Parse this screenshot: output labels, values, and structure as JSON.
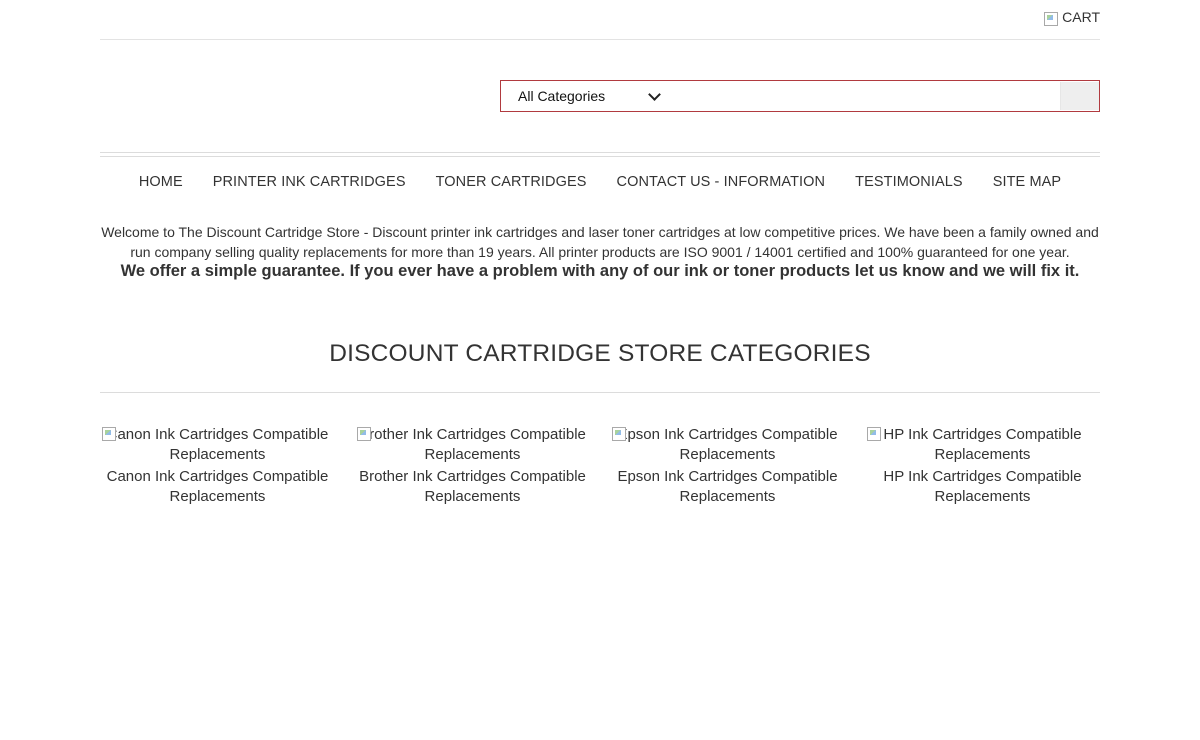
{
  "topbar": {
    "cart_label": "CART"
  },
  "search": {
    "category_selected": "All Categories",
    "input_value": "",
    "input_placeholder": ""
  },
  "nav": [
    "HOME",
    "PRINTER INK CARTRIDGES",
    "TONER CARTRIDGES",
    "CONTACT US - INFORMATION",
    "TESTIMONIALS",
    "SITE MAP"
  ],
  "welcome": {
    "text": "Welcome to The Discount Cartridge Store - Discount printer ink cartridges and laser toner cartridges at low competitive prices. We have been a family owned and run company selling quality replacements for more than 19 years. All printer products are ISO 9001 / 14001 certified and 100% guaranteed for one year.",
    "guarantee": "We offer a simple guarantee. If you ever have a problem with any of our ink or toner products let us know and we will fix it."
  },
  "categories": {
    "title": "DISCOUNT CARTRIDGE STORE CATEGORIES",
    "items": [
      {
        "alt": "Canon Ink Cartridges Compatible Replacements",
        "name": "Canon Ink Cartridges Compatible Replacements"
      },
      {
        "alt": "Brother Ink Cartridges Compatible Replacements",
        "name": "Brother Ink Cartridges Compatible Replacements"
      },
      {
        "alt": "Epson Ink Cartridges Compatible Replacements",
        "name": "Epson Ink Cartridges Compatible Replacements"
      },
      {
        "alt": "HP Ink Cartridges Compatible Replacements",
        "name": "HP Ink Cartridges Compatible Replacements"
      }
    ]
  },
  "icons": {
    "cart": "broken-image-icon",
    "select": "chevron-down-icon",
    "category_images": "broken-image-icon"
  },
  "colors": {
    "search_border": "#b13a3f",
    "text": "#333333",
    "rule": "#dcdcdc"
  }
}
